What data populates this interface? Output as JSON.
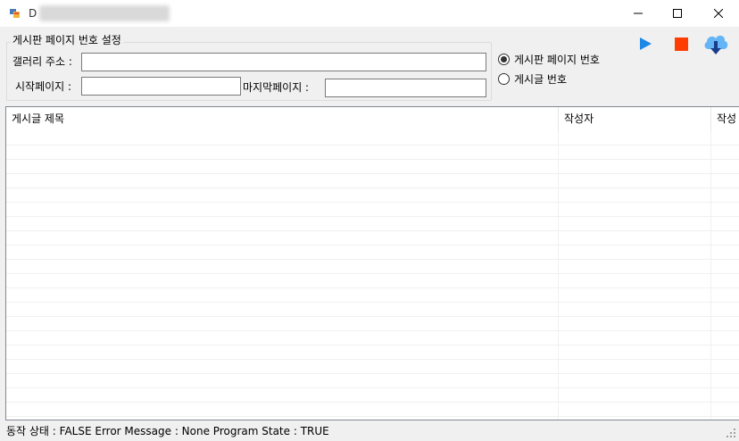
{
  "window": {
    "title_visible": "D"
  },
  "settings_group": {
    "legend": "게시판 페이지 번호 설정",
    "gallery_label": "갤러리 주소 :",
    "gallery_value": "",
    "start_page_label": "시작페이지 :",
    "start_page_value": "",
    "last_page_label": "마지막페이지 :",
    "last_page_value": ""
  },
  "mode": {
    "options": [
      {
        "label": "게시판 페이지 번호",
        "checked": true
      },
      {
        "label": "게시글 번호",
        "checked": false
      }
    ]
  },
  "toolbar": {
    "play_icon": "play-icon",
    "stop_icon": "stop-icon",
    "download_icon": "cloud-download-icon",
    "colors": {
      "play": "#1e88e5",
      "stop": "#ff3d00",
      "cloud": "#64b5f6",
      "arrow": "#1a3a8a"
    }
  },
  "list": {
    "columns": [
      "게시글 제목",
      "작성자",
      "작성"
    ],
    "rows": []
  },
  "status": {
    "text": "동작 상태 : FALSE  Error Message : None  Program State : TRUE"
  }
}
